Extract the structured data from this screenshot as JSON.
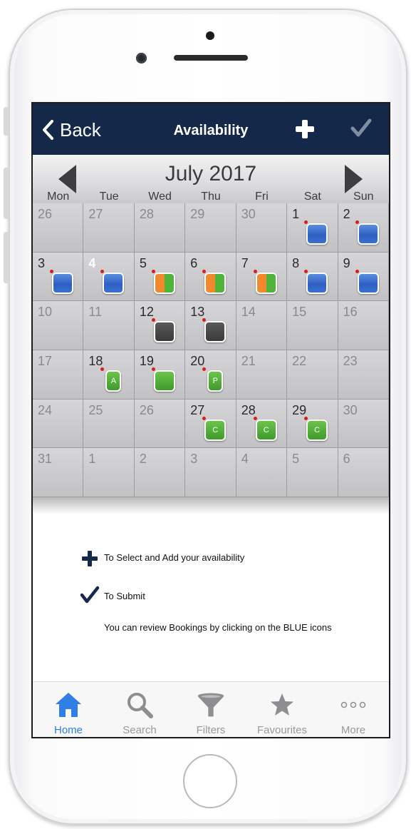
{
  "navbar": {
    "back_label": "Back",
    "title": "Availability"
  },
  "calendar": {
    "month_title": "July 2017",
    "weekdays": [
      "Mon",
      "Tue",
      "Wed",
      "Thu",
      "Fri",
      "Sat",
      "Sun"
    ],
    "cells": [
      {
        "day": "26",
        "in_month": false
      },
      {
        "day": "27",
        "in_month": false
      },
      {
        "day": "28",
        "in_month": false
      },
      {
        "day": "29",
        "in_month": false
      },
      {
        "day": "30",
        "in_month": false
      },
      {
        "day": "1",
        "in_month": true,
        "badge": "blue"
      },
      {
        "day": "2",
        "in_month": true,
        "badge": "blue"
      },
      {
        "day": "3",
        "in_month": true,
        "badge": "blue"
      },
      {
        "day": "4",
        "in_month": true,
        "today": true,
        "badge": "blue"
      },
      {
        "day": "5",
        "in_month": true,
        "badge": "orange-green"
      },
      {
        "day": "6",
        "in_month": true,
        "badge": "orange-green"
      },
      {
        "day": "7",
        "in_month": true,
        "badge": "orange-green"
      },
      {
        "day": "8",
        "in_month": true,
        "badge": "blue"
      },
      {
        "day": "9",
        "in_month": true,
        "badge": "blue"
      },
      {
        "day": "10",
        "in_month": false
      },
      {
        "day": "11",
        "in_month": false
      },
      {
        "day": "12",
        "in_month": true,
        "badge": "gray"
      },
      {
        "day": "13",
        "in_month": true,
        "badge": "gray"
      },
      {
        "day": "14",
        "in_month": false
      },
      {
        "day": "15",
        "in_month": false
      },
      {
        "day": "16",
        "in_month": false
      },
      {
        "day": "17",
        "in_month": false
      },
      {
        "day": "18",
        "in_month": true,
        "badge": "green-narrow",
        "badge_text": "A"
      },
      {
        "day": "19",
        "in_month": true,
        "badge": "green"
      },
      {
        "day": "20",
        "in_month": true,
        "badge": "green-narrow",
        "badge_text": "P"
      },
      {
        "day": "21",
        "in_month": false
      },
      {
        "day": "22",
        "in_month": false
      },
      {
        "day": "23",
        "in_month": false
      },
      {
        "day": "24",
        "in_month": false
      },
      {
        "day": "25",
        "in_month": false
      },
      {
        "day": "26",
        "in_month": false
      },
      {
        "day": "27",
        "in_month": true,
        "badge": "green",
        "badge_text": "C"
      },
      {
        "day": "28",
        "in_month": true,
        "badge": "green",
        "badge_text": "C"
      },
      {
        "day": "29",
        "in_month": true,
        "badge": "green",
        "badge_text": "C"
      },
      {
        "day": "30",
        "in_month": false
      },
      {
        "day": "31",
        "in_month": false
      },
      {
        "day": "1",
        "in_month": false
      },
      {
        "day": "2",
        "in_month": false
      },
      {
        "day": "3",
        "in_month": false
      },
      {
        "day": "4",
        "in_month": false
      },
      {
        "day": "5",
        "in_month": false
      },
      {
        "day": "6",
        "in_month": false
      }
    ]
  },
  "legend": {
    "add_text": "To Select and Add your availability",
    "submit_text": "To Submit",
    "note": "You can review Bookings by clicking on the BLUE icons"
  },
  "tabbar": {
    "tabs": [
      {
        "label": "Home",
        "icon": "home-icon",
        "active": true
      },
      {
        "label": "Search",
        "icon": "search-icon",
        "active": false
      },
      {
        "label": "Filters",
        "icon": "filter-icon",
        "active": false
      },
      {
        "label": "Favourites",
        "icon": "star-icon",
        "active": false
      },
      {
        "label": "More",
        "icon": "more-icon",
        "active": false
      }
    ]
  },
  "colors": {
    "navbar_bg": "#14294a",
    "tab_active": "#2f7fe6",
    "tab_inactive": "#9a9a9d",
    "badge_blue": "#2e5fc2",
    "badge_green": "#4fb43a",
    "badge_orange": "#f08a2c",
    "badge_gray": "#4a4a4a",
    "marker_red": "#d51e1e"
  }
}
